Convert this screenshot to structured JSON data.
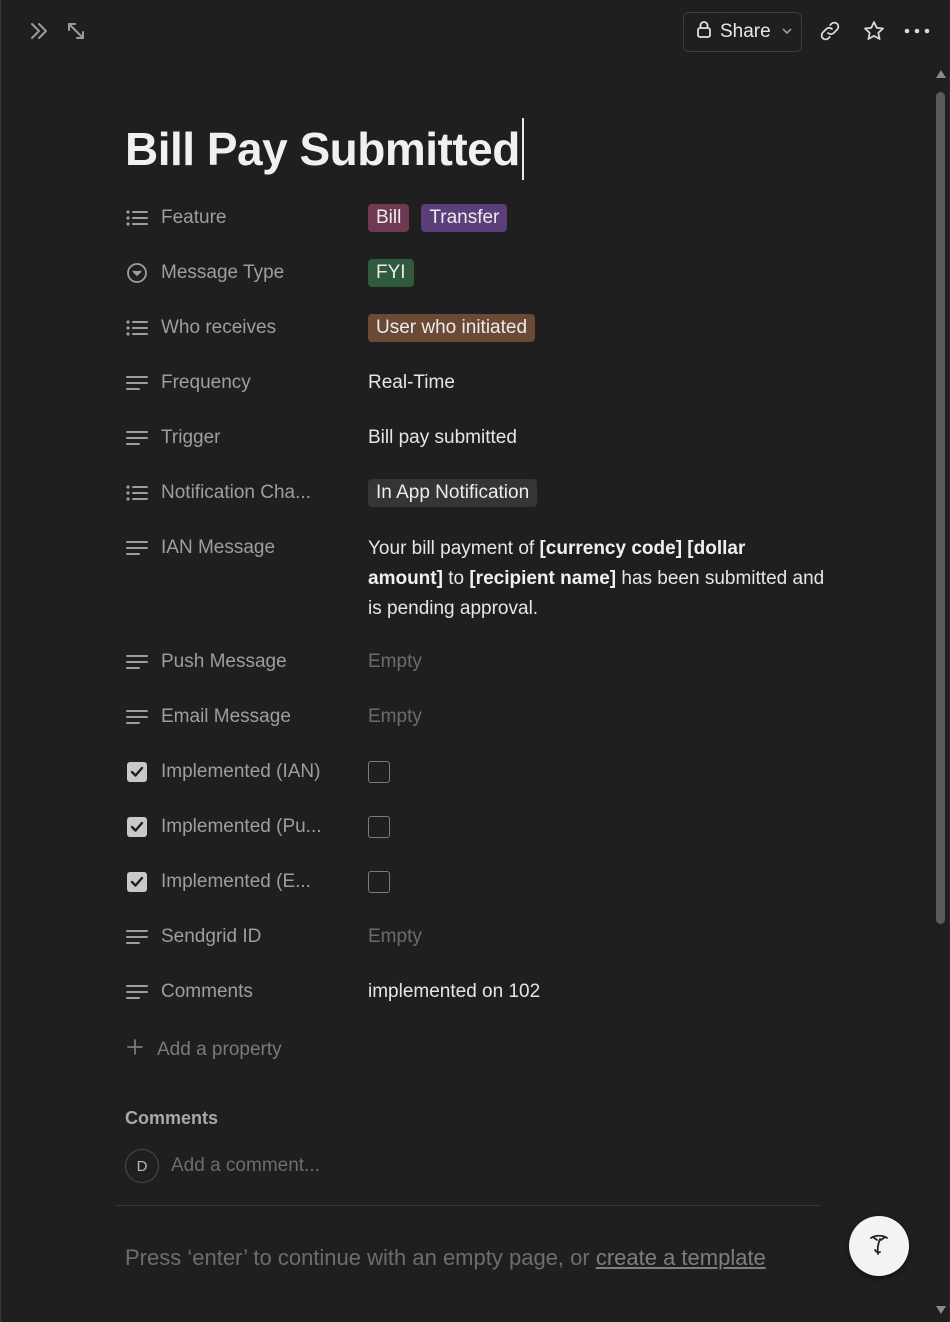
{
  "topbar": {
    "share_label": "Share"
  },
  "page": {
    "title": "Bill Pay Submitted"
  },
  "properties": {
    "feature": {
      "name": "Feature",
      "tags": [
        "Bill",
        "Transfer"
      ]
    },
    "message_type": {
      "name": "Message Type",
      "tag": "FYI"
    },
    "who_receives": {
      "name": "Who receives",
      "tag": "User who initiated"
    },
    "frequency": {
      "name": "Frequency",
      "value": "Real-Time"
    },
    "trigger": {
      "name": "Trigger",
      "value": "Bill pay submitted"
    },
    "notification_channel": {
      "name": "Notification Cha...",
      "tag": "In App Notification"
    },
    "ian_message": {
      "name": "IAN Message",
      "part1": "Your bill payment of ",
      "bold1": "[currency code] [dollar amount]",
      "part2": " to ",
      "bold2": "[recipient name]",
      "part3": " has been submitted and is pending approval."
    },
    "push_message": {
      "name": "Push Message",
      "value": "Empty"
    },
    "email_message": {
      "name": "Email Message",
      "value": "Empty"
    },
    "implemented_ian": {
      "name": "Implemented (IAN)",
      "checked": false
    },
    "implemented_push": {
      "name": "Implemented (Pu...",
      "checked": false
    },
    "implemented_email": {
      "name": "Implemented (E...",
      "checked": false
    },
    "sendgrid_id": {
      "name": "Sendgrid ID",
      "value": "Empty"
    },
    "comments": {
      "name": "Comments",
      "value": "implemented on 102"
    }
  },
  "add_property_label": "Add a property",
  "comments_section": {
    "heading": "Comments",
    "avatar_initial": "D",
    "placeholder": "Add a comment..."
  },
  "hint": {
    "text": "Press ‘enter’ to continue with an empty page, or ",
    "link": "create a template"
  },
  "colors": {
    "background": "#1f1f1f",
    "tag_pink": "#6e3a52",
    "tag_purple": "#5b3f7a",
    "tag_green": "#2f5a3c",
    "tag_brown": "#6a4a36",
    "tag_gray": "#353535"
  }
}
